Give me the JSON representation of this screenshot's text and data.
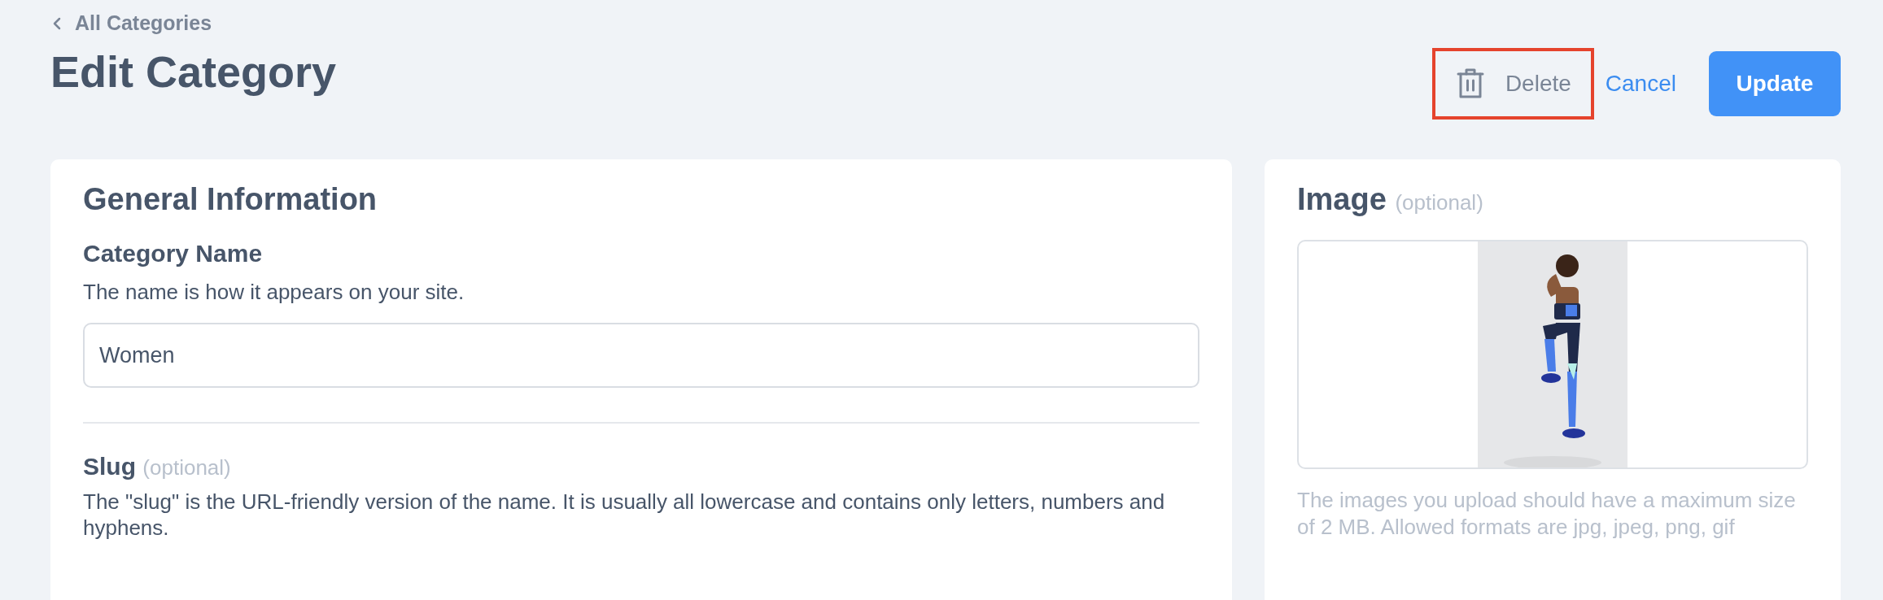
{
  "back_link": {
    "label": "All Categories"
  },
  "page_title": "Edit Category",
  "actions": [
    {
      "kind": "delete",
      "label": "Delete",
      "highlighted": true
    },
    {
      "kind": "cancel",
      "label": "Cancel"
    },
    {
      "kind": "update",
      "label": "Update"
    }
  ],
  "general": {
    "title": "General Information",
    "category_name": {
      "label": "Category Name",
      "description": "The name is how it appears on your site.",
      "value": "Women"
    },
    "slug": {
      "label": "Slug",
      "optional_note": "(optional)",
      "description": "The \"slug\" is the URL-friendly version of the name. It is usually all lowercase and contains only letters, numbers and hyphens."
    }
  },
  "image": {
    "title": "Image",
    "optional_note": "(optional)",
    "help": "The images you upload should have a maximum size of 2 MB. Allowed formats are jpg, jpeg, png, gif"
  }
}
